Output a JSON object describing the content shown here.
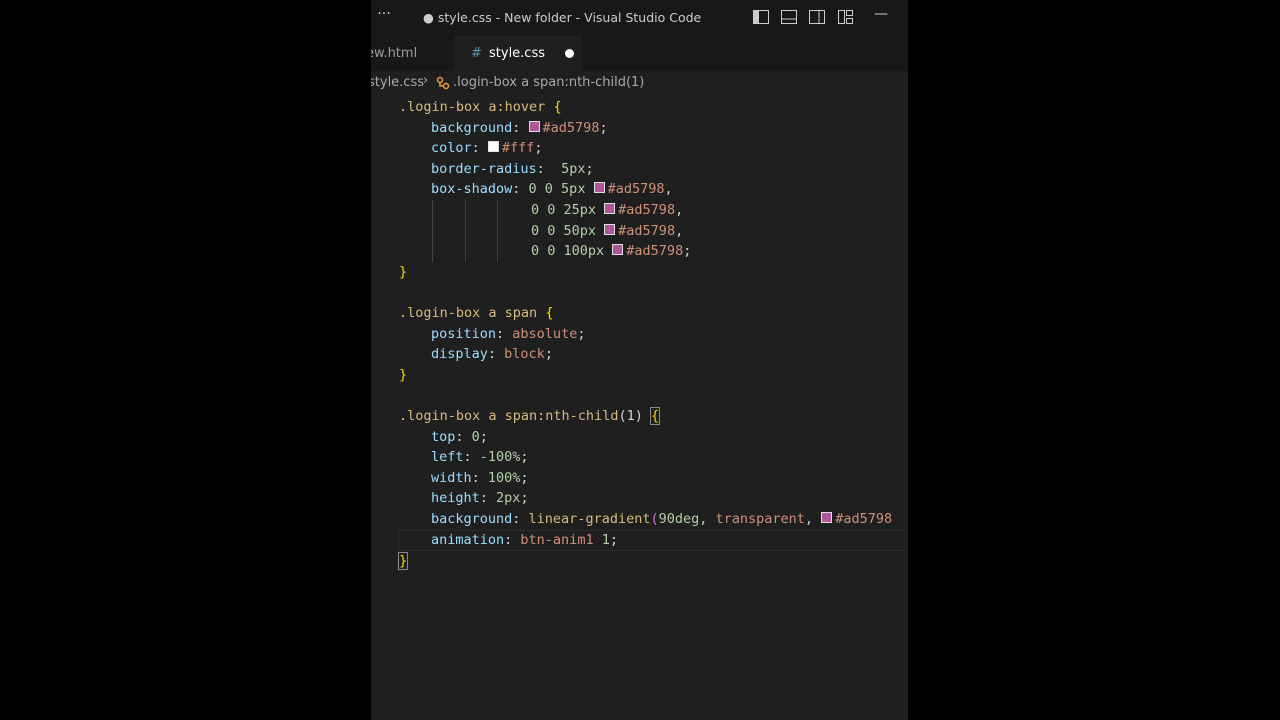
{
  "window": {
    "title": "● style.css - New folder - Visual Studio Code",
    "menu_glyph": "···",
    "minimize_glyph": "—"
  },
  "tabs": [
    {
      "label": "ew.html",
      "active": false
    },
    {
      "label": "style.css",
      "active": true,
      "icon": "#",
      "dirty": true
    }
  ],
  "breadcrumb": {
    "file": "style.css",
    "separator": "›",
    "symbol_icon": "css-selector-icon",
    "symbol": ".login-box a span:nth-child(1)"
  },
  "colors": {
    "swatch_purple": "#ad5798",
    "swatch_white": "#ffffff",
    "selector": "#d7ba7d",
    "property": "#9cdcfe",
    "value": "#ce9178",
    "number": "#b5cea8"
  },
  "code": {
    "l1_sel": ".login-box a:hover",
    "l1_brace": "{",
    "l2_prop": "background",
    "l2_val": "#ad5798",
    "l3_prop": "color",
    "l3_val": "#fff",
    "l4_prop": "border-radius",
    "l4_val": "5px",
    "l5_prop": "box-shadow",
    "l5_nums": "0 0 5px",
    "l5_val": "#ad5798",
    "l6_nums": "0 0 25px",
    "l6_val": "#ad5798",
    "l7_nums": "0 0 50px",
    "l7_val": "#ad5798",
    "l8_nums": "0 0 100px",
    "l8_val": "#ad5798",
    "l9_brace": "}",
    "l11_sel": ".login-box a span",
    "l11_brace": "{",
    "l12_prop": "position",
    "l12_val": "absolute",
    "l13_prop": "display",
    "l13_val": "block",
    "l14_brace": "}",
    "l16_sel": ".login-box a span:nth-child",
    "l16_paren": "(1)",
    "l16_brace": "{",
    "l17_prop": "top",
    "l17_val": "0",
    "l18_prop": "left",
    "l18_val": "-100%",
    "l19_prop": "width",
    "l19_val": "100%",
    "l20_prop": "height",
    "l20_val": "2px",
    "l21_prop": "background",
    "l21_fn": "linear-gradient",
    "l21_deg": "90deg",
    "l21_kw": "transparent",
    "l21_val": "#ad5798",
    "l22_prop": "animation",
    "l22_name": "btn-anim1",
    "l22_num": "1",
    "l23_brace": "}"
  }
}
